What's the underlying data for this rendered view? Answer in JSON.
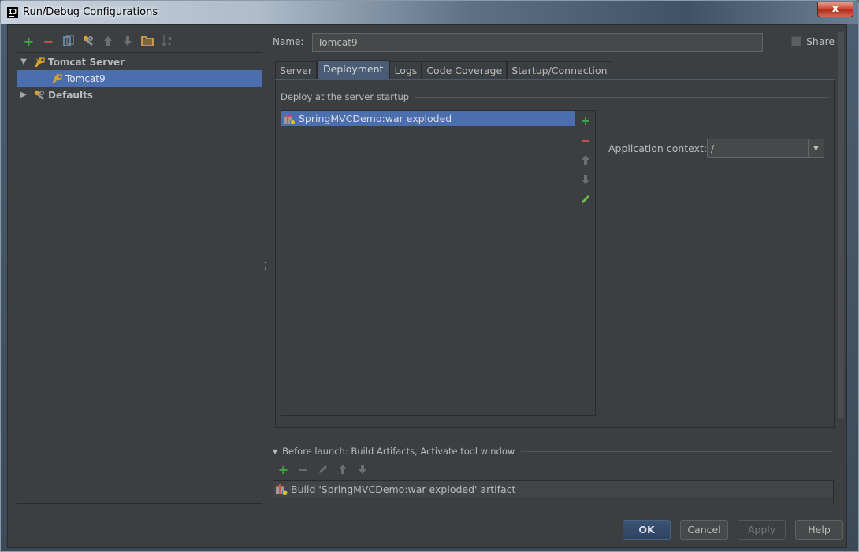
{
  "window": {
    "title": "Run/Debug Configurations",
    "app_logo": "IJ",
    "close_label": "x"
  },
  "left_toolbar": {
    "buttons": [
      {
        "name": "add",
        "glyph": "+",
        "color": "#3fa845"
      },
      {
        "name": "remove",
        "glyph": "−",
        "color": "#c75450"
      },
      {
        "name": "copy",
        "glyph": "⎘",
        "color": "#6f9cc8"
      },
      {
        "name": "edit-defaults",
        "glyph": "🔧",
        "color": "#d8a030"
      },
      {
        "name": "move-up",
        "glyph": "⬆",
        "color": "#6e6e6e"
      },
      {
        "name": "move-down",
        "glyph": "⬇",
        "color": "#6e6e6e"
      },
      {
        "name": "folder",
        "glyph": "▭",
        "color": "#d8a050"
      },
      {
        "name": "sort",
        "glyph": "↓ᵃz",
        "color": "#6e6e6e"
      }
    ]
  },
  "tree": {
    "items": [
      {
        "label": "Tomcat Server",
        "expanded": true,
        "bold": true
      },
      {
        "label": "Tomcat9",
        "selected": true
      },
      {
        "label": "Defaults",
        "expanded": false,
        "bold": true
      }
    ]
  },
  "form": {
    "name_label": "Name:",
    "name_value": "Tomcat9",
    "share_label": "Share",
    "share_checked": false
  },
  "tabs": [
    {
      "label": "Server",
      "active": false
    },
    {
      "label": "Deployment",
      "active": true
    },
    {
      "label": "Logs",
      "active": false
    },
    {
      "label": "Code Coverage",
      "active": false
    },
    {
      "label": "Startup/Connection",
      "active": false
    }
  ],
  "deployment": {
    "section_title": "Deploy at the server startup",
    "artifacts": [
      "SpringMVCDemo:war exploded"
    ],
    "side_buttons": [
      {
        "name": "add",
        "glyph": "+",
        "color": "#3fa845"
      },
      {
        "name": "remove",
        "glyph": "−",
        "color": "#c75450"
      },
      {
        "name": "move-up",
        "glyph": "⬆",
        "color": "#6e6e6e"
      },
      {
        "name": "move-down",
        "glyph": "⬇",
        "color": "#6e6e6e"
      },
      {
        "name": "edit",
        "glyph": "✎",
        "color": "#6cc04a"
      }
    ],
    "app_context_label": "Application context:",
    "app_context_value": "/"
  },
  "before_launch": {
    "title": "Before launch: Build Artifacts, Activate tool window",
    "buttons": [
      {
        "name": "add",
        "glyph": "+",
        "color": "#3fa845"
      },
      {
        "name": "remove",
        "glyph": "−",
        "color": "#6e6e6e"
      },
      {
        "name": "edit",
        "glyph": "✎",
        "color": "#6e6e6e"
      },
      {
        "name": "move-up",
        "glyph": "⬆",
        "color": "#6e6e6e"
      },
      {
        "name": "move-down",
        "glyph": "⬇",
        "color": "#6e6e6e"
      }
    ],
    "tasks": [
      "Build 'SpringMVCDemo:war exploded' artifact"
    ]
  },
  "buttons": {
    "ok": "OK",
    "cancel": "Cancel",
    "apply": "Apply",
    "help": "Help"
  }
}
